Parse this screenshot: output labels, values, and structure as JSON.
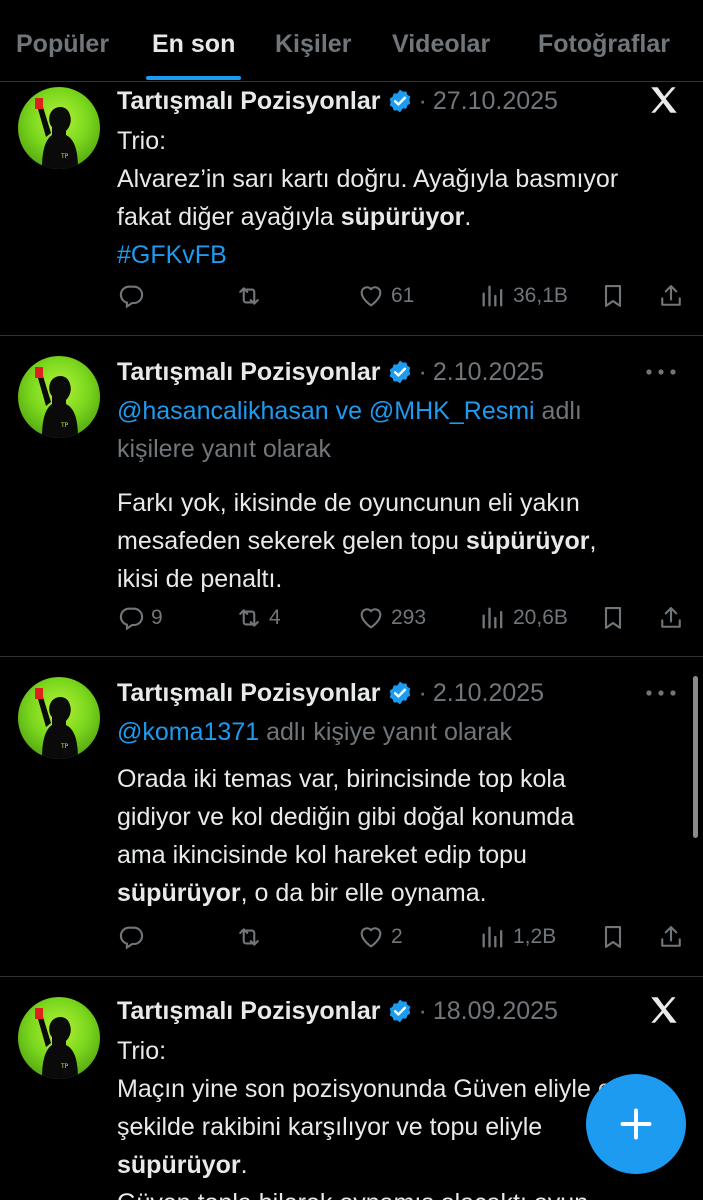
{
  "tabs": [
    {
      "label": "Popüler"
    },
    {
      "label": "En son"
    },
    {
      "label": "Kişiler"
    },
    {
      "label": "Videolar"
    },
    {
      "label": "Fotoğraflar"
    }
  ],
  "active_tab": "En son",
  "accent_color": "#1d9bf0",
  "avatar_text": "TP",
  "tweets": [
    {
      "author": "Tartışmalı Pozisyonlar",
      "separator": "·",
      "date": "27.10.2025",
      "corner_icon": "x-logo-icon",
      "line1": "Trio:",
      "line2": "Alvarez’in sarı kartı doğru. Ayağıyla basmıyor",
      "line3a": "fakat diğer ayağıyla ",
      "line3b": "süpürüyor",
      "line3c": ".",
      "hashtag": "#GFKvFB",
      "replies": "",
      "retweets": "",
      "likes": "61",
      "views": "36,1B"
    },
    {
      "author": "Tartışmalı Pozisyonlar",
      "separator": "·",
      "date": "2.10.2025",
      "corner_icon": "more-icon",
      "mention1": "@hasancalikhasan",
      "mention_join": " ve ",
      "mention2": "@MHK_Resmi",
      "reply_suffix1": " adlı",
      "reply_suffix2": "kişilere yanıt olarak",
      "line1": "Farkı yok, ikisinde de oyuncunun eli yakın",
      "line2a": "mesafeden sekerek gelen topu ",
      "line2b": "süpürüyor",
      "line2c": ",",
      "line3": "ikisi de penaltı.",
      "replies": "9",
      "retweets": "4",
      "likes": "293",
      "views": "20,6B"
    },
    {
      "author": "Tartışmalı Pozisyonlar",
      "separator": "·",
      "date": "2.10.2025",
      "corner_icon": "more-icon",
      "mention1": "@koma1371",
      "reply_suffix": " adlı kişiye yanıt olarak",
      "line1": "Orada iki temas var, birincisinde top kola",
      "line2": "gidiyor ve kol dediğin gibi doğal konumda",
      "line3": "ama ikincisinde kol hareket edip topu",
      "line4a": "süpürüyor",
      "line4b": ", o da bir elle oynama.",
      "replies": "",
      "retweets": "",
      "likes": "2",
      "views": "1,2B"
    },
    {
      "author": "Tartışmalı Pozisyonlar",
      "separator": "·",
      "date": "18.09.2025",
      "corner_icon": "x-logo-icon",
      "line1": "Trio:",
      "line2": "Maçın yine son pozisyonunda Güven eliyle ok",
      "line3": "şekilde rakibini karşılıyor ve topu eliyle",
      "line4a": "süpürüyor",
      "line4b": ".",
      "line5": "Güven topla bilerek oynamış olacaktı oyun"
    }
  ]
}
